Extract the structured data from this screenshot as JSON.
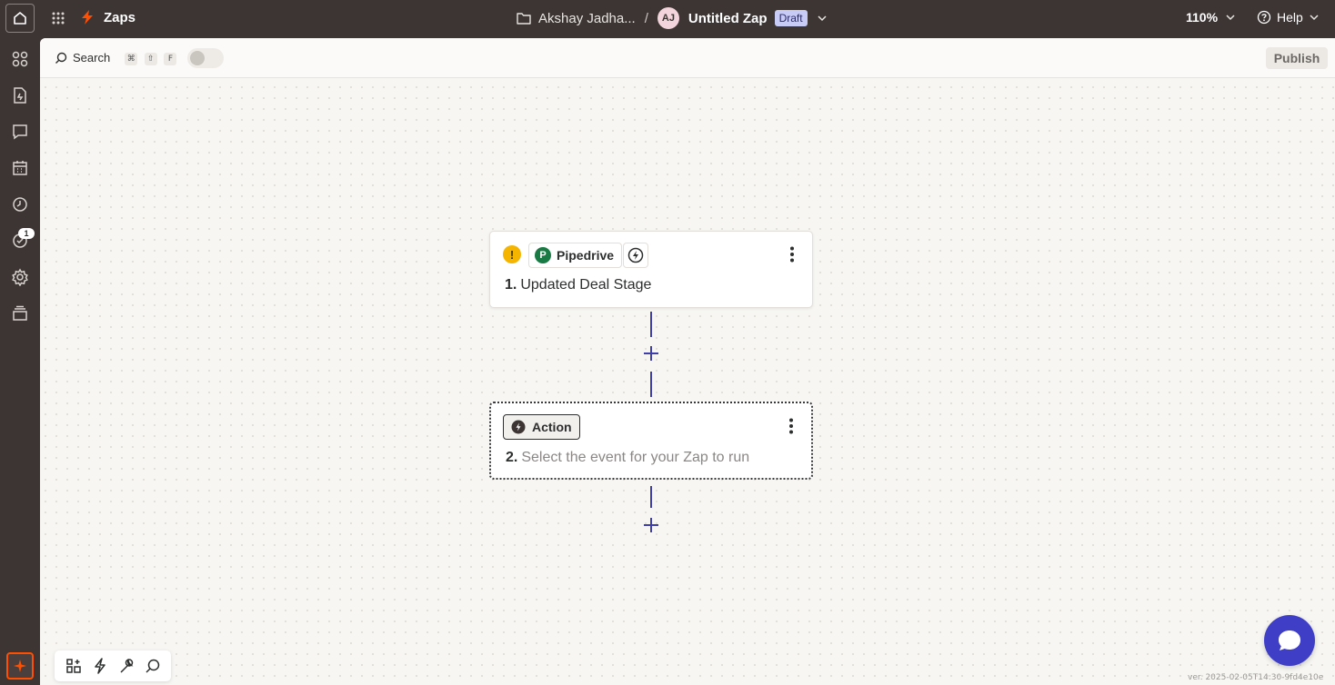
{
  "topbar": {
    "brand_label": "Zaps",
    "breadcrumb_folder": "Akshay Jadha...",
    "breadcrumb_separator": "/",
    "avatar_initials": "AJ",
    "zap_title": "Untitled Zap",
    "status_badge": "Draft",
    "zoom_level": "110%",
    "help_label": "Help"
  },
  "rail": {
    "items": [
      "apps-icon",
      "file-icon",
      "chat-icon",
      "calendar-icon",
      "history-icon",
      "notifications-icon",
      "settings-icon",
      "layers-icon"
    ],
    "notification_count": "1"
  },
  "subbar": {
    "search_label": "Search",
    "shortcut_keys": [
      "⌘",
      "⇧",
      "F"
    ],
    "publish_label": "Publish"
  },
  "steps": [
    {
      "app_name": "Pipedrive",
      "app_logo_letter": "P",
      "number": "1.",
      "title": "Updated Deal Stage",
      "warning": "!"
    },
    {
      "chip_label": "Action",
      "number": "2.",
      "title": "Select the event for your Zap to run"
    }
  ],
  "footer": {
    "version": "ver. 2025-02-05T14:30-9fd4e10e"
  },
  "colors": {
    "brand_orange": "#ff4f00",
    "accent_blue": "#3e3fa9",
    "chat_fab": "#3f3ec7",
    "warning_yellow": "#f4b400",
    "pipedrive_green": "#1a7a43"
  }
}
